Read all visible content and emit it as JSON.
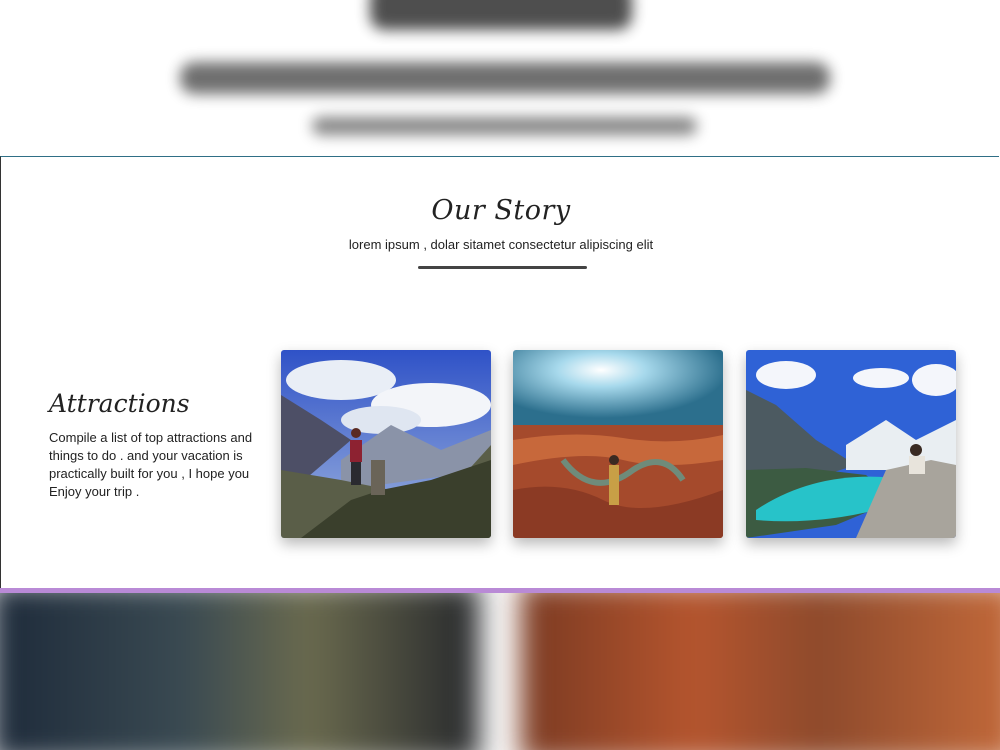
{
  "story": {
    "title": "Our Story",
    "subtitle": "lorem ipsum , dolar sitamet consectetur alipiscing elit"
  },
  "attractions": {
    "title": "Attractions",
    "text": "Compile a list of top attractions and things to do . and your vacation is practically built for you , I hope you Enjoy your trip ."
  },
  "cards": [
    {
      "image": "hiker-mountain-photo"
    },
    {
      "image": "canyon-bend-photo"
    },
    {
      "image": "turquoise-lake-photo"
    }
  ],
  "colors": {
    "accent_band": "#b98ad6",
    "divider": "#444444",
    "text": "#222222"
  }
}
